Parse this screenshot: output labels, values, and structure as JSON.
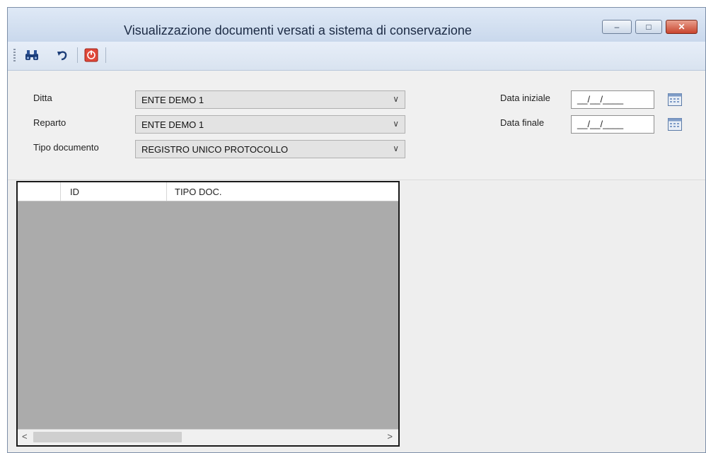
{
  "window": {
    "title": "Visualizzazione documenti versati a sistema di conservazione",
    "minimize_glyph": "–",
    "maximize_glyph": "□",
    "close_glyph": "✕"
  },
  "toolbar": {
    "items": [
      "binoculars-search-icon",
      "undo-icon",
      "exit-icon"
    ]
  },
  "form": {
    "ditta": {
      "label": "Ditta",
      "value": "ENTE DEMO 1"
    },
    "reparto": {
      "label": "Reparto",
      "value": "ENTE DEMO 1"
    },
    "tipo_documento": {
      "label": "Tipo documento",
      "value": "REGISTRO UNICO PROTOCOLLO"
    },
    "data_iniziale": {
      "label": "Data iniziale",
      "value": "__/__/____"
    },
    "data_finale": {
      "label": "Data finale",
      "value": "__/__/____"
    },
    "dropdown_glyph": "∨"
  },
  "grid": {
    "columns": [
      "ID",
      "TIPO DOC."
    ],
    "rows": [],
    "scroll_left": "<",
    "scroll_right": ">"
  },
  "colors": {
    "titlebar": "#c9d8ec",
    "grid_background": "#ababab",
    "close_button": "#c9452e",
    "exit_icon": "#e0483a"
  }
}
